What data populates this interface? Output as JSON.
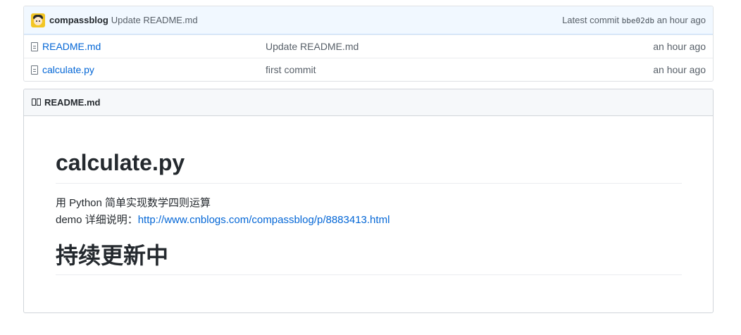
{
  "commit": {
    "author": "compassblog",
    "message": "Update README.md",
    "latest_label": "Latest commit",
    "sha": "bbe02db",
    "age": "an hour ago"
  },
  "files": [
    {
      "name": "README.md",
      "commit": "Update README.md",
      "age": "an hour ago"
    },
    {
      "name": "calculate.py",
      "commit": "first commit",
      "age": "an hour ago"
    }
  ],
  "readme": {
    "header": "README.md",
    "title": "calculate.py",
    "line1": "用 Python 简单实现数学四则运算",
    "line2_prefix": "demo 详细说明：",
    "link": "http://www.cnblogs.com/compassblog/p/8883413.html",
    "heading2": "持续更新中"
  },
  "colors": {
    "link": "#0366d6",
    "commit_bar_bg": "#f1f8ff",
    "header_bg": "#f6f8fa"
  },
  "icons": {
    "file": "file-icon",
    "book": "book-icon",
    "avatar": "avatar"
  }
}
